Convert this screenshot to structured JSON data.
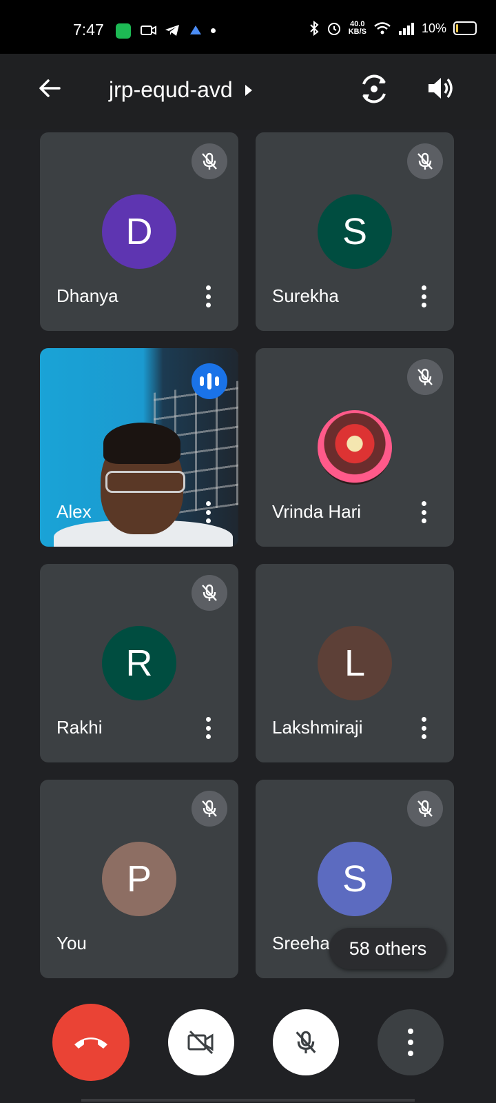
{
  "status_bar": {
    "time": "7:47",
    "net_speed_value": "40.0",
    "net_speed_unit": "KB/S",
    "battery": "10%"
  },
  "header": {
    "title": "jrp-equd-avd"
  },
  "participants": [
    {
      "name": "Dhanya",
      "initial": "D",
      "avatar_color": "#5e35b1",
      "muted": true
    },
    {
      "name": "Surekha",
      "initial": "S",
      "avatar_color": "#004d40",
      "muted": true
    },
    {
      "name": "Alex",
      "initial": "",
      "video": true,
      "speaking": true
    },
    {
      "name": "Vrinda Hari",
      "initial": "",
      "photo_avatar": true,
      "muted": true
    },
    {
      "name": "Rakhi",
      "initial": "R",
      "avatar_color": "#004d40",
      "muted": true
    },
    {
      "name": "Lakshmiraji",
      "initial": "L",
      "avatar_color": "#5d4037",
      "muted": true
    },
    {
      "name": "You",
      "initial": "P",
      "avatar_color": "#8d6e63",
      "muted": true
    },
    {
      "name": "Sreehari",
      "initial": "S",
      "avatar_color": "#5c6bc0",
      "muted": true
    }
  ],
  "others_chip": "58 others",
  "controls": {
    "end_call_color": "#ea4335"
  }
}
